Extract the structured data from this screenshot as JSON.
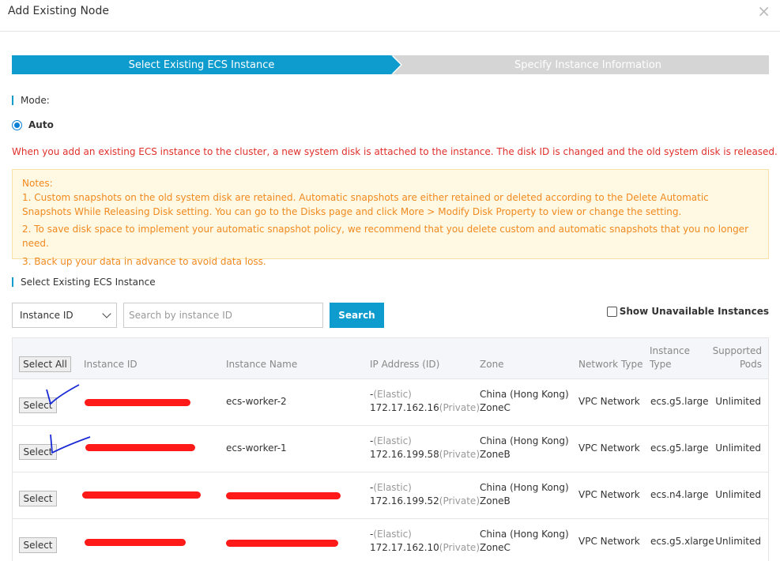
{
  "dialog": {
    "title": "Add Existing Node",
    "close_symbol": "×"
  },
  "steps": {
    "step1": "Select Existing ECS Instance",
    "step2": "Specify Instance Information"
  },
  "mode": {
    "label": "Mode:",
    "option": "Auto"
  },
  "warning": "When you add an existing ECS instance to the cluster, a new system disk is attached to the instance. The disk ID is changed and the old system disk is released.",
  "notes": {
    "heading": "Notes:",
    "items": [
      "1. Custom snapshots on the old system disk are retained. Automatic snapshots are either retained or deleted according to the Delete Automatic Snapshots While Releasing Disk setting. You can go to the Disks page and click More > Modify Disk Property to view or change the setting.",
      "2. To save disk space to implement your automatic snapshot policy, we recommend that you delete custom and automatic snapshots that you no longer need.",
      "3. Back up your data in advance to avoid data loss."
    ]
  },
  "instance_section": {
    "label": "Select Existing ECS Instance",
    "filter_select": "Instance ID",
    "search_placeholder": "Search by instance ID",
    "search_button": "Search",
    "show_unavailable": "Show Unavailable Instances"
  },
  "table": {
    "select_all": "Select All",
    "columns": {
      "instance_id": "Instance ID",
      "instance_name": "Instance Name",
      "ip": "IP Address (ID)",
      "zone": "Zone",
      "network": "Network Type",
      "instance_type_1": "Instance",
      "instance_type_2": "Type",
      "pods_1": "Supported",
      "pods_2": "Pods"
    },
    "rows": [
      {
        "select": "Select",
        "name": "ecs-worker-2",
        "ip_elastic_prefix": "-",
        "ip_elastic_suffix": "(Elastic)",
        "ip_private": "172.17.162.16",
        "ip_private_suffix": "(Private)",
        "zone_1": "China (Hong Kong)",
        "zone_2": "ZoneC",
        "network": "VPC Network",
        "type": "ecs.g5.large",
        "pods": "Unlimited"
      },
      {
        "select": "Select",
        "name": "ecs-worker-1",
        "ip_elastic_prefix": "-",
        "ip_elastic_suffix": "(Elastic)",
        "ip_private": "172.16.199.58",
        "ip_private_suffix": "(Private)",
        "zone_1": "China (Hong Kong)",
        "zone_2": "ZoneB",
        "network": "VPC Network",
        "type": "ecs.g5.large",
        "pods": "Unlimited"
      },
      {
        "select": "Select",
        "name": "",
        "ip_elastic_prefix": "-",
        "ip_elastic_suffix": "(Elastic)",
        "ip_private": "172.16.199.52",
        "ip_private_suffix": "(Private)",
        "zone_1": "China (Hong Kong)",
        "zone_2": "ZoneB",
        "network": "VPC Network",
        "type": "ecs.n4.large",
        "pods": "Unlimited"
      },
      {
        "select": "Select",
        "name": "",
        "ip_elastic_prefix": "-",
        "ip_elastic_suffix": "(Elastic)",
        "ip_private": "172.17.162.10",
        "ip_private_suffix": "(Private)",
        "zone_1": "China (Hong Kong)",
        "zone_2": "ZoneC",
        "network": "VPC Network",
        "type": "ecs.g5.xlarge",
        "pods": "Unlimited"
      }
    ]
  },
  "colors": {
    "accent": "#0e9bcd",
    "warning_text": "#e0302b",
    "notes_text": "#f08a1f",
    "notes_bg": "#fff8e3",
    "redaction": "#ff1a1a",
    "hand_check": "#1a2bd6"
  }
}
